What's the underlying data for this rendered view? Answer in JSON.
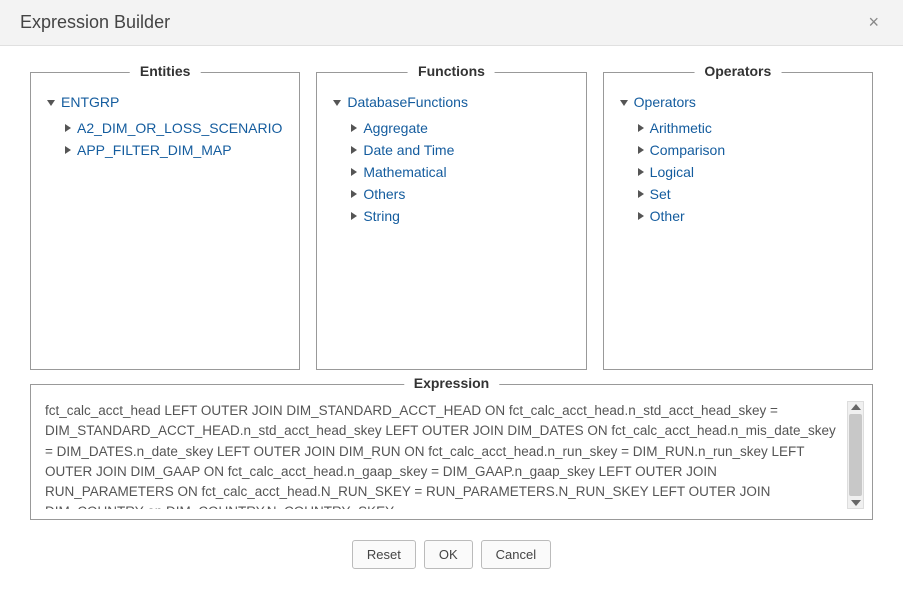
{
  "dialog": {
    "title": "Expression Builder"
  },
  "panels": {
    "entities": {
      "legend": "Entities",
      "root": "ENTGRP",
      "items": [
        "A2_DIM_OR_LOSS_SCENARIO",
        "APP_FILTER_DIM_MAP"
      ]
    },
    "functions": {
      "legend": "Functions",
      "root": "DatabaseFunctions",
      "items": [
        "Aggregate",
        "Date and Time",
        "Mathematical",
        "Others",
        "String"
      ]
    },
    "operators": {
      "legend": "Operators",
      "root": "Operators",
      "items": [
        "Arithmetic",
        "Comparison",
        "Logical",
        "Set",
        "Other"
      ]
    }
  },
  "expression": {
    "legend": "Expression",
    "text": "fct_calc_acct_head   LEFT OUTER JOIN DIM_STANDARD_ACCT_HEAD ON fct_calc_acct_head.n_std_acct_head_skey = DIM_STANDARD_ACCT_HEAD.n_std_acct_head_skey   LEFT OUTER JOIN DIM_DATES ON fct_calc_acct_head.n_mis_date_skey = DIM_DATES.n_date_skey   LEFT OUTER JOIN DIM_RUN ON fct_calc_acct_head.n_run_skey = DIM_RUN.n_run_skey   LEFT OUTER JOIN DIM_GAAP ON fct_calc_acct_head.n_gaap_skey = DIM_GAAP.n_gaap_skey   LEFT OUTER JOIN RUN_PARAMETERS ON fct_calc_acct_head.N_RUN_SKEY = RUN_PARAMETERS.N_RUN_SKEY   LEFT OUTER JOIN DIM_COUNTRY on DIM_COUNTRY.N_COUNTRY_SKEY ="
  },
  "buttons": {
    "reset": "Reset",
    "ok": "OK",
    "cancel": "Cancel"
  }
}
